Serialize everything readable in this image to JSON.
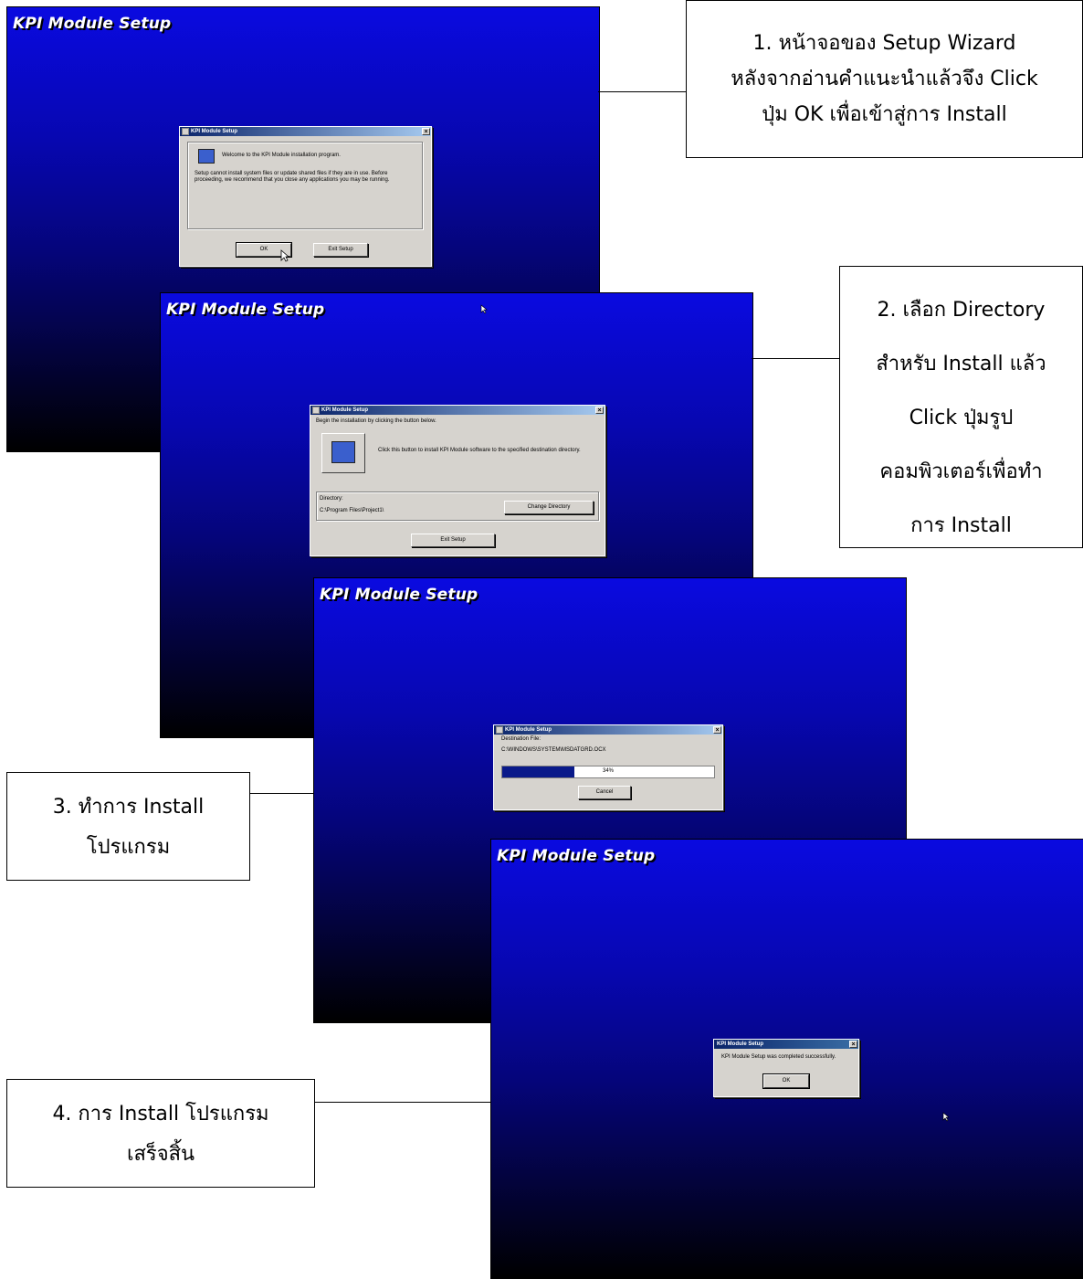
{
  "screens": {
    "s1": {
      "title": "KPI Module Setup"
    },
    "s2": {
      "title": "KPI Module Setup"
    },
    "s3": {
      "title": "KPI Module Setup"
    },
    "s4": {
      "title": "KPI Module Setup"
    }
  },
  "dialog1": {
    "title": "KPI Module Setup",
    "welcome": "Welcome to the KPI Module installation program.",
    "warning": "Setup cannot install system files or update shared files if they are in use. Before proceeding, we recommend that you close any applications you may be running.",
    "ok_label": "OK",
    "exit_label": "Exit Setup"
  },
  "dialog2": {
    "title": "KPI Module Setup",
    "instruction": "Begin the installation by clicking the button below.",
    "install_hint": "Click this button to install KPI Module software to the specified destination directory.",
    "directory_label": "Directory:",
    "directory_value": "C:\\Program Files\\Project1\\",
    "change_dir_label": "Change Directory",
    "exit_label": "Exit Setup"
  },
  "dialog3": {
    "title": "KPI Module Setup",
    "dest_label": "Destination File:",
    "dest_value": "C:\\WINDOWS\\SYSTEM\\MSDATGRD.OCX",
    "progress_text": "34%",
    "progress": 0.34,
    "cancel_label": "Cancel"
  },
  "dialog4": {
    "title": "KPI Module Setup",
    "message": "KPI Module Setup was completed successfully.",
    "ok_label": "OK"
  },
  "callouts": {
    "c1": [
      "1. หน้าจอของ Setup Wizard",
      "หลังจากอ่านคำแนะนำแล้วจึง Click",
      "ปุ่ม OK เพื่อเข้าสู่การ Install"
    ],
    "c2": [
      "2. เลือก Directory",
      "สำหรับ Install แล้ว",
      "Click ปุ่มรูป",
      "คอมพิวเตอร์เพื่อทำ",
      "การ Install"
    ],
    "c3": [
      "3. ทำการ Install",
      "โปรแกรม"
    ],
    "c4": [
      "4. การ Install โปรแกรม",
      "เสร็จสิ้น"
    ]
  },
  "colors": {
    "screen_top": "#0a0ae0",
    "screen_bottom": "#000000",
    "dialog_face": "#d6d3ce",
    "titlebar": "#0a246a",
    "progress_fill": "#0a1a8a"
  },
  "icons": [
    "computer-install-icon",
    "setup-icon",
    "close-icon",
    "mouse-cursor-icon"
  ]
}
